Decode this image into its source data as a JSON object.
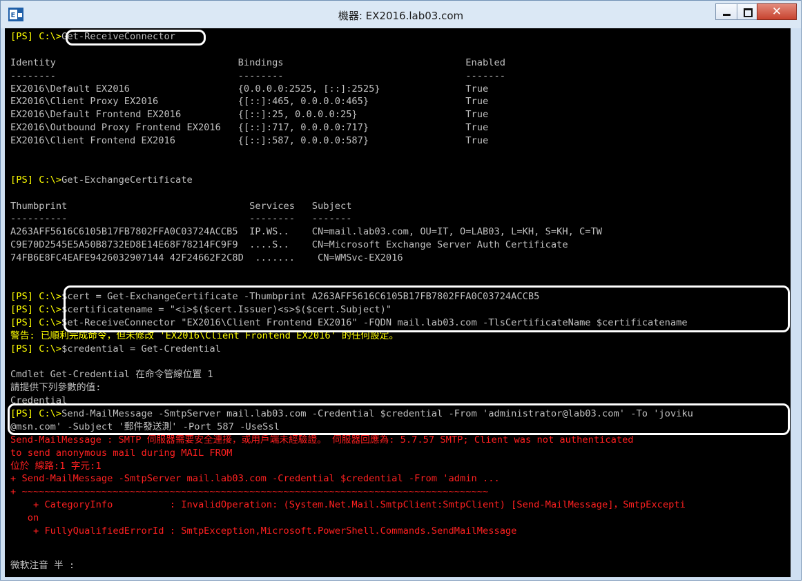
{
  "window": {
    "title": "機器: EX2016.lab03.com"
  },
  "controls": {
    "close_label": "✕"
  },
  "console": {
    "prompt": "[PS] C:\\>",
    "lines": [
      "Get-ReceiveConnector",
      "",
      "Identity                                Bindings                                Enabled",
      "--------                                --------                                -------",
      "EX2016\\Default EX2016                   {0.0.0.0:2525, [::]:2525}               True",
      "EX2016\\Client Proxy EX2016              {[::]:465, 0.0.0.0:465}                 True",
      "EX2016\\Default Frontend EX2016          {[::]:25, 0.0.0.0:25}                   True",
      "EX2016\\Outbound Proxy Frontend EX2016   {[::]:717, 0.0.0.0:717}                 True",
      "EX2016\\Client Frontend EX2016           {[::]:587, 0.0.0.0:587}                 True",
      "",
      "",
      "Get-ExchangeCertificate",
      "",
      "Thumbprint                                Services   Subject",
      "----------                                --------   -------",
      "A263AFF5616C6105B17FB7802FFA0C03724ACCB5  IP.WS..    CN=mail.lab03.com, OU=IT, O=LAB03, L=KH, S=KH, C=TW",
      "C9E70D2545E5A50B8732ED8E14E68F78214FC9F9  ....S..    CN=Microsoft Exchange Server Auth Certificate",
      "74FB6E8FC4EAFE9426032907144 42F24662F2C8D  .......    CN=WMSvc-EX2016",
      "",
      "",
      "$cert = Get-ExchangeCertificate -Thumbprint A263AFF5616C6105B17FB7802FFA0C03724ACCB5",
      "$certificatename = \"<i>$($cert.Issuer)<s>$($cert.Subject)\"",
      "Set-ReceiveConnector \"EX2016\\Client Frontend EX2016\" -FQDN mail.lab03.com -TlsCertificateName $certificatename",
      "警告: 已順利完成命令，但未修改 'EX2016\\Client Frontend EX2016' 的任何設定。",
      "$credential = Get-Credential",
      "",
      "Cmdlet Get-Credential 在命令管線位置 1",
      "請提供下列參數的值:",
      "Credential",
      "Send-MailMessage -SmtpServer mail.lab03.com -Credential $credential -From 'administrator@lab03.com' -To 'joviku",
      "@msn.com' -Subject '郵件發送測' -Port 587 -UseSsl",
      "Send-MailMessage : SMTP 伺服器需要安全連接，或用戶端未經驗證。 伺服器回應為: 5.7.57 SMTP; Client was not authenticated",
      "to send anonymous mail during MAIL FROM",
      "位於 線路:1 字元:1",
      "+ Send-MailMessage -SmtpServer mail.lab03.com -Credential $credential -From 'admin ...",
      "+ ~~~~~~~~~~~~~~~~~~~~~~~~~~~~~~~~~~~~~~~~~~~~~~~~~~~~~~~~~~~~~~~~~~~~~~~~~~~~~~~~~~",
      "    + CategoryInfo          : InvalidOperation: (System.Net.Mail.SmtpClient:SmtpClient) [Send-MailMessage]，SmtpExcepti",
      "   on",
      "    + FullyQualifiedErrorId : SmtpException,Microsoft.PowerShell.Commands.SendMailMessage",
      "",
      "",
      "微軟注音 半 :"
    ]
  },
  "colors": {
    "prompt": "#ffff00",
    "error": "#ff2020",
    "output": "#c0c0c0",
    "highlight": "#ffffff"
  }
}
